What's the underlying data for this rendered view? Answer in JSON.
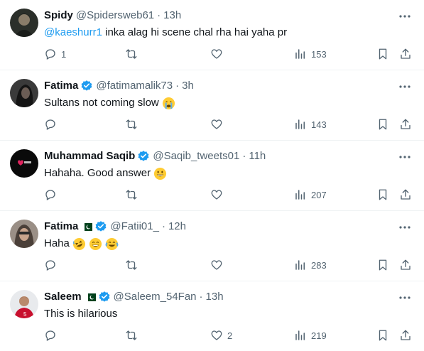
{
  "tweets": [
    {
      "name": "Spidy",
      "handle": "@Spidersweb61",
      "time": "13h",
      "verified": false,
      "flag": false,
      "mention": "@kaeshurr1",
      "text": " inka alag hi scene chal rha hai yaha pr",
      "emojis": [],
      "replies": "1",
      "retweets": "",
      "likes": "",
      "views": "153"
    },
    {
      "name": "Fatima",
      "handle": "@fatimamalik73",
      "time": "3h",
      "verified": true,
      "flag": false,
      "mention": "",
      "text": "Sultans not coming slow",
      "emojis": [
        "crying-face"
      ],
      "replies": "",
      "retweets": "",
      "likes": "",
      "views": "143"
    },
    {
      "name": "Muhammad Saqib",
      "handle": "@Saqib_tweets01",
      "time": "11h",
      "verified": true,
      "flag": false,
      "mention": "",
      "text": "Hahaha. Good answer",
      "emojis": [
        "grinning-face"
      ],
      "replies": "",
      "retweets": "",
      "likes": "",
      "views": "207"
    },
    {
      "name": "Fatima",
      "handle": "@Fatii01_",
      "time": "12h",
      "verified": true,
      "flag": true,
      "mention": "",
      "text": "Haha",
      "emojis": [
        "rofl-face",
        "smile-face",
        "joy-face"
      ],
      "replies": "",
      "retweets": "",
      "likes": "",
      "views": "283"
    },
    {
      "name": "Saleem",
      "handle": "@Saleem_54Fan",
      "time": "13h",
      "verified": true,
      "flag": true,
      "mention": "",
      "text": "This is hilarious",
      "emojis": [],
      "replies": "",
      "retweets": "",
      "likes": "2",
      "views": "219"
    }
  ],
  "colors": {
    "accent": "#1d9bf0",
    "secondary_text": "#536471",
    "divider": "#eff3f4",
    "flag_green": "#01411c"
  },
  "icons": [
    "more-icon",
    "reply-icon",
    "retweet-icon",
    "like-icon",
    "views-icon",
    "bookmark-icon",
    "share-icon",
    "verified-badge-icon",
    "pakistan-flag-icon"
  ]
}
